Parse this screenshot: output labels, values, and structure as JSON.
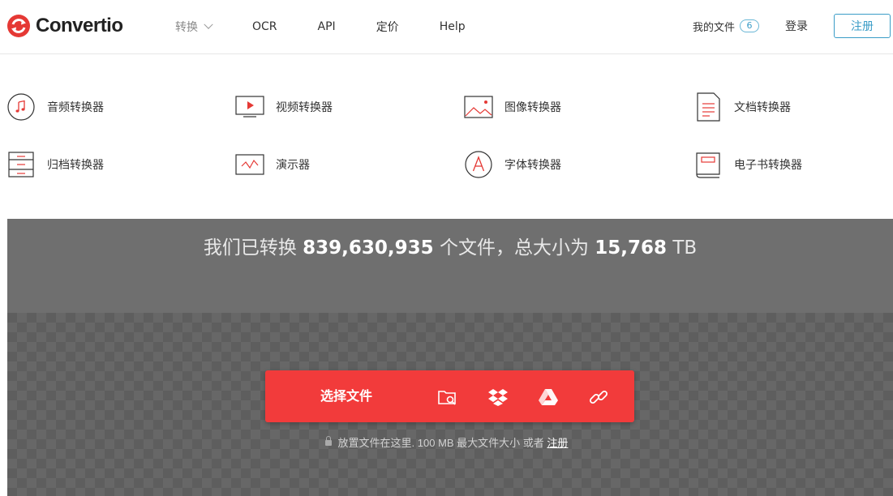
{
  "brand": {
    "name": "Convertio",
    "color": "#e53935"
  },
  "nav": {
    "items": [
      {
        "label": "转换",
        "active": true,
        "has_dropdown": true
      },
      {
        "label": "OCR"
      },
      {
        "label": "API"
      },
      {
        "label": "定价"
      },
      {
        "label": "Help"
      }
    ]
  },
  "account": {
    "my_files_label": "我的文件",
    "files_count": "6",
    "login_label": "登录",
    "register_label": "注册"
  },
  "converters": [
    {
      "label": "音频转换器",
      "icon": "music-note-icon"
    },
    {
      "label": "视频转换器",
      "icon": "video-play-icon"
    },
    {
      "label": "图像转换器",
      "icon": "image-icon"
    },
    {
      "label": "文档转换器",
      "icon": "document-icon"
    },
    {
      "label": "归档转换器",
      "icon": "archive-icon"
    },
    {
      "label": "演示器",
      "icon": "presentation-icon"
    },
    {
      "label": "字体转换器",
      "icon": "font-icon"
    },
    {
      "label": "电子书转换器",
      "icon": "ebook-icon"
    }
  ],
  "stats": {
    "prefix": "我们已转换",
    "files_converted": "839,630,935",
    "middle": "个文件，总大小为",
    "total_size": "15,768",
    "unit": "TB"
  },
  "upload": {
    "choose_label": "选择文件",
    "sources": [
      "folder-search-icon",
      "dropbox-icon",
      "google-drive-icon",
      "url-link-icon"
    ],
    "note_text": "放置文件在这里. 100 MB 最大文件大小 或者",
    "note_link": "注册"
  },
  "colors": {
    "accent": "#f23b3b",
    "link_blue": "#3a9cc7",
    "hero_gray": "#6f6f6f"
  }
}
